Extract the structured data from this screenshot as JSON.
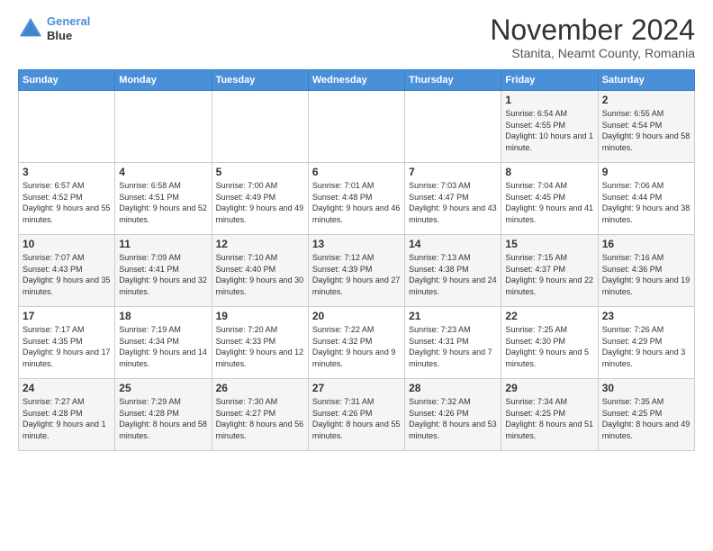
{
  "logo": {
    "line1": "General",
    "line2": "Blue"
  },
  "title": "November 2024",
  "subtitle": "Stanita, Neamt County, Romania",
  "headers": [
    "Sunday",
    "Monday",
    "Tuesday",
    "Wednesday",
    "Thursday",
    "Friday",
    "Saturday"
  ],
  "weeks": [
    [
      {
        "day": "",
        "info": ""
      },
      {
        "day": "",
        "info": ""
      },
      {
        "day": "",
        "info": ""
      },
      {
        "day": "",
        "info": ""
      },
      {
        "day": "",
        "info": ""
      },
      {
        "day": "1",
        "info": "Sunrise: 6:54 AM\nSunset: 4:55 PM\nDaylight: 10 hours and 1 minute."
      },
      {
        "day": "2",
        "info": "Sunrise: 6:55 AM\nSunset: 4:54 PM\nDaylight: 9 hours and 58 minutes."
      }
    ],
    [
      {
        "day": "3",
        "info": "Sunrise: 6:57 AM\nSunset: 4:52 PM\nDaylight: 9 hours and 55 minutes."
      },
      {
        "day": "4",
        "info": "Sunrise: 6:58 AM\nSunset: 4:51 PM\nDaylight: 9 hours and 52 minutes."
      },
      {
        "day": "5",
        "info": "Sunrise: 7:00 AM\nSunset: 4:49 PM\nDaylight: 9 hours and 49 minutes."
      },
      {
        "day": "6",
        "info": "Sunrise: 7:01 AM\nSunset: 4:48 PM\nDaylight: 9 hours and 46 minutes."
      },
      {
        "day": "7",
        "info": "Sunrise: 7:03 AM\nSunset: 4:47 PM\nDaylight: 9 hours and 43 minutes."
      },
      {
        "day": "8",
        "info": "Sunrise: 7:04 AM\nSunset: 4:45 PM\nDaylight: 9 hours and 41 minutes."
      },
      {
        "day": "9",
        "info": "Sunrise: 7:06 AM\nSunset: 4:44 PM\nDaylight: 9 hours and 38 minutes."
      }
    ],
    [
      {
        "day": "10",
        "info": "Sunrise: 7:07 AM\nSunset: 4:43 PM\nDaylight: 9 hours and 35 minutes."
      },
      {
        "day": "11",
        "info": "Sunrise: 7:09 AM\nSunset: 4:41 PM\nDaylight: 9 hours and 32 minutes."
      },
      {
        "day": "12",
        "info": "Sunrise: 7:10 AM\nSunset: 4:40 PM\nDaylight: 9 hours and 30 minutes."
      },
      {
        "day": "13",
        "info": "Sunrise: 7:12 AM\nSunset: 4:39 PM\nDaylight: 9 hours and 27 minutes."
      },
      {
        "day": "14",
        "info": "Sunrise: 7:13 AM\nSunset: 4:38 PM\nDaylight: 9 hours and 24 minutes."
      },
      {
        "day": "15",
        "info": "Sunrise: 7:15 AM\nSunset: 4:37 PM\nDaylight: 9 hours and 22 minutes."
      },
      {
        "day": "16",
        "info": "Sunrise: 7:16 AM\nSunset: 4:36 PM\nDaylight: 9 hours and 19 minutes."
      }
    ],
    [
      {
        "day": "17",
        "info": "Sunrise: 7:17 AM\nSunset: 4:35 PM\nDaylight: 9 hours and 17 minutes."
      },
      {
        "day": "18",
        "info": "Sunrise: 7:19 AM\nSunset: 4:34 PM\nDaylight: 9 hours and 14 minutes."
      },
      {
        "day": "19",
        "info": "Sunrise: 7:20 AM\nSunset: 4:33 PM\nDaylight: 9 hours and 12 minutes."
      },
      {
        "day": "20",
        "info": "Sunrise: 7:22 AM\nSunset: 4:32 PM\nDaylight: 9 hours and 9 minutes."
      },
      {
        "day": "21",
        "info": "Sunrise: 7:23 AM\nSunset: 4:31 PM\nDaylight: 9 hours and 7 minutes."
      },
      {
        "day": "22",
        "info": "Sunrise: 7:25 AM\nSunset: 4:30 PM\nDaylight: 9 hours and 5 minutes."
      },
      {
        "day": "23",
        "info": "Sunrise: 7:26 AM\nSunset: 4:29 PM\nDaylight: 9 hours and 3 minutes."
      }
    ],
    [
      {
        "day": "24",
        "info": "Sunrise: 7:27 AM\nSunset: 4:28 PM\nDaylight: 9 hours and 1 minute."
      },
      {
        "day": "25",
        "info": "Sunrise: 7:29 AM\nSunset: 4:28 PM\nDaylight: 8 hours and 58 minutes."
      },
      {
        "day": "26",
        "info": "Sunrise: 7:30 AM\nSunset: 4:27 PM\nDaylight: 8 hours and 56 minutes."
      },
      {
        "day": "27",
        "info": "Sunrise: 7:31 AM\nSunset: 4:26 PM\nDaylight: 8 hours and 55 minutes."
      },
      {
        "day": "28",
        "info": "Sunrise: 7:32 AM\nSunset: 4:26 PM\nDaylight: 8 hours and 53 minutes."
      },
      {
        "day": "29",
        "info": "Sunrise: 7:34 AM\nSunset: 4:25 PM\nDaylight: 8 hours and 51 minutes."
      },
      {
        "day": "30",
        "info": "Sunrise: 7:35 AM\nSunset: 4:25 PM\nDaylight: 8 hours and 49 minutes."
      }
    ]
  ]
}
